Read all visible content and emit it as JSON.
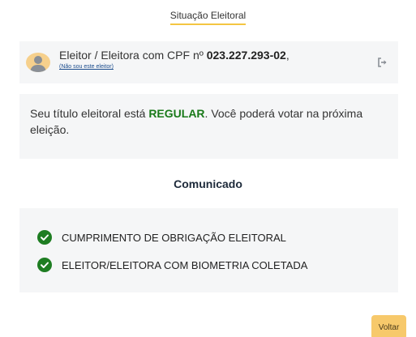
{
  "header": {
    "title": "Situação Eleitoral"
  },
  "voter": {
    "prefix": "Eleitor / Eleitora com CPF nº ",
    "cpf": "023.227.293-02",
    "suffix": ",",
    "not_you_link": "(Não sou este eleitor)",
    "logout_icon": "sign-out-icon"
  },
  "status": {
    "before": "Seu título eleitoral está ",
    "value": "REGULAR",
    "after": ". Você poderá votar na próxima eleição.",
    "value_color": "#1a7a1a"
  },
  "communique": {
    "heading": "Comunicado",
    "items": [
      {
        "label": "CUMPRIMENTO DE OBRIGAÇÃO ELEITORAL",
        "icon": "check-circle-icon"
      },
      {
        "label": "ELEITOR/ELEITORA COM BIOMETRIA COLETADA",
        "icon": "check-circle-icon"
      }
    ]
  },
  "footer": {
    "back_label": "Voltar"
  },
  "colors": {
    "accent": "#f4c542",
    "success": "#1e7d22",
    "card_bg": "#f5f6f7",
    "button_bg": "#f7c96b"
  }
}
